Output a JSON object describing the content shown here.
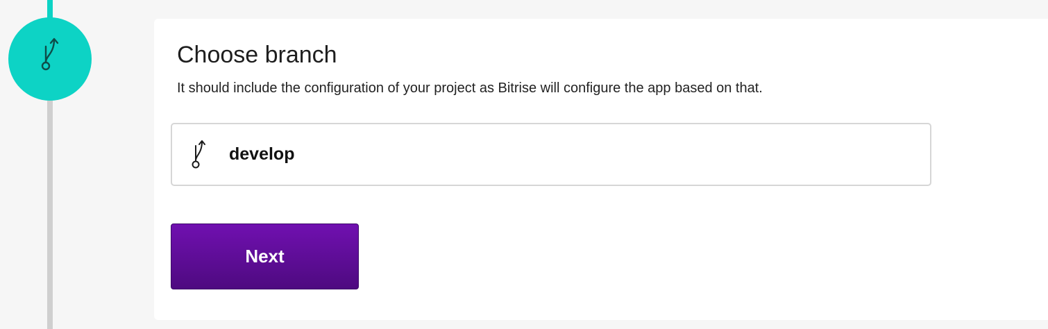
{
  "step": {
    "icon": "git-branch-icon"
  },
  "card": {
    "title": "Choose branch",
    "subtitle": "It should include the configuration of your project as Bitrise will configure the app based on that."
  },
  "branch_select": {
    "icon": "git-branch-icon",
    "selected_value": "develop"
  },
  "actions": {
    "next_label": "Next"
  },
  "colors": {
    "accent_teal": "#0dd3c5",
    "button_purple": "#6a0fa8",
    "timeline_inactive": "#cfcfcf",
    "page_background": "#f6f6f6"
  }
}
